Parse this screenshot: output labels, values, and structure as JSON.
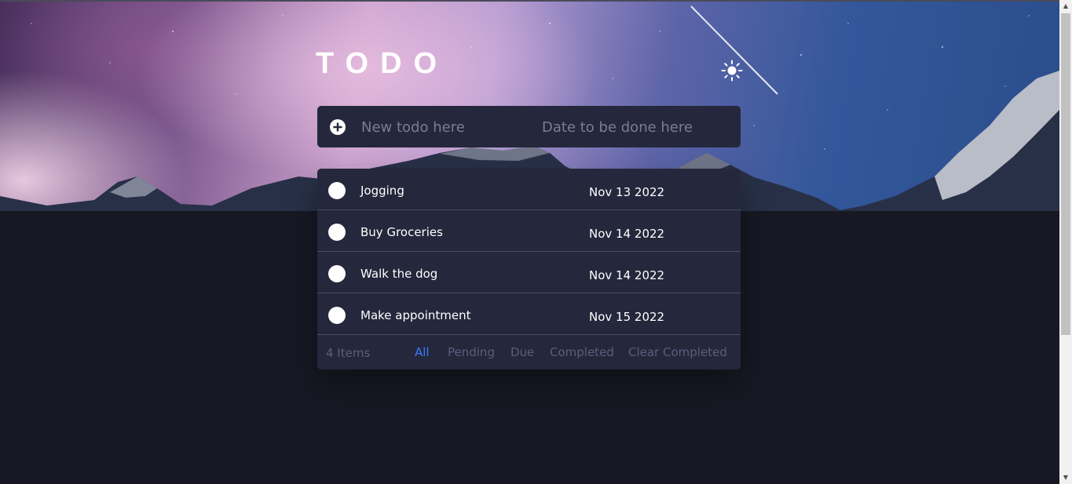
{
  "header": {
    "title": "TODO",
    "theme_icon": "sun-icon"
  },
  "new_todo": {
    "add_icon": "plus-circle-icon",
    "todo_placeholder": "New todo here",
    "todo_value": "",
    "date_placeholder": "Date to be done here",
    "date_value": ""
  },
  "todos": [
    {
      "text": "Jogging",
      "date": "Nov 13 2022",
      "completed": false
    },
    {
      "text": "Buy Groceries",
      "date": "Nov 14 2022",
      "completed": false
    },
    {
      "text": "Walk the dog",
      "date": "Nov 14 2022",
      "completed": false
    },
    {
      "text": "Make appointment",
      "date": "Nov 15 2022",
      "completed": false
    }
  ],
  "footer": {
    "count": "4 Items",
    "filters": [
      "All",
      "Pending",
      "Due",
      "Completed"
    ],
    "active_filter": "All",
    "clear_label": "Clear Completed"
  },
  "colors": {
    "background": "#181824",
    "card": "#25273c",
    "accent": "#3a7bfd",
    "muted": "#5b5e7e"
  }
}
